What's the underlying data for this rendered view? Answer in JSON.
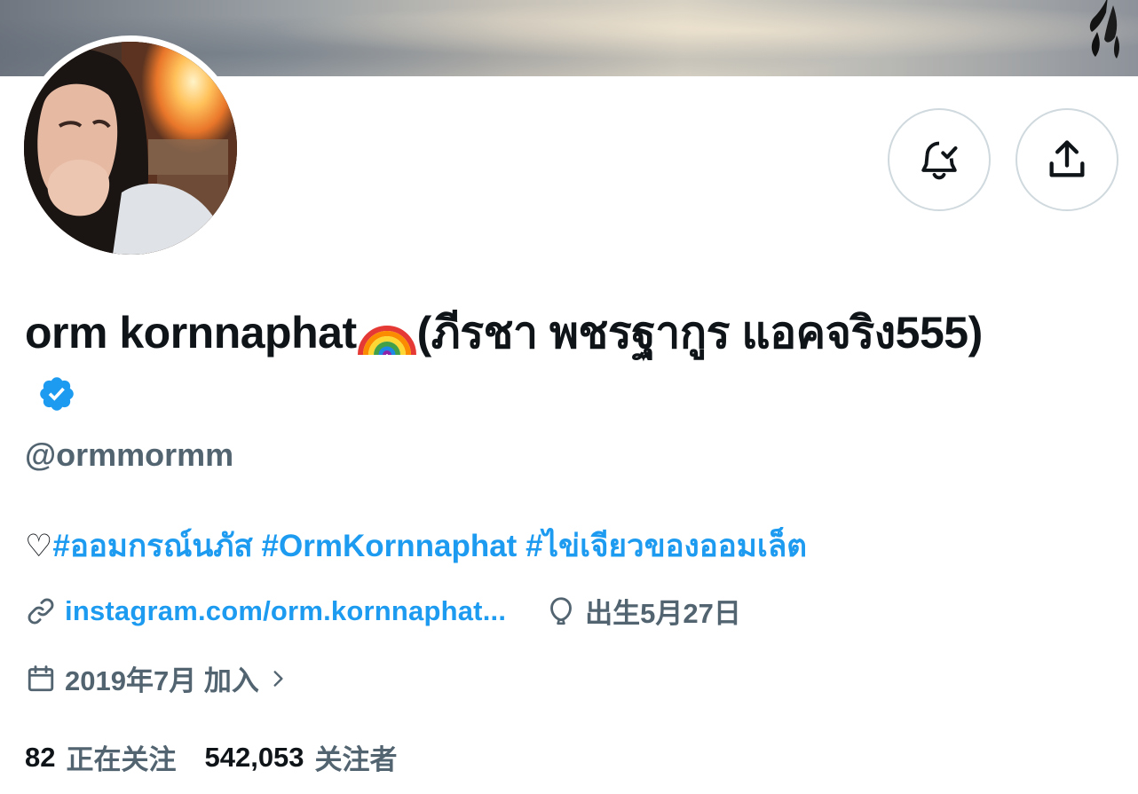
{
  "profile": {
    "name": "orm kornnaphat",
    "name_suffix": "(ภีรชา พชรฐากูร แอคจริง555)",
    "handle": "@ormmormm",
    "bio": {
      "heart": "♡",
      "hashtags": [
        "#ออมกรณ์นภัส",
        "#OrmKornnaphat",
        "#ไข่เจียวของออมเล็ต"
      ]
    },
    "website": "instagram.com/orm.kornnaphat...",
    "birthday": "出生5月27日",
    "joined": "2019年7月 加入",
    "following_count": "82",
    "following_label": "正在关注",
    "followers_count": "542,053",
    "followers_label": "关注者"
  },
  "icons": {
    "notify": "bell-check-icon",
    "share": "share-upload-icon",
    "verified": "verified-badge-icon",
    "link": "link-icon",
    "birthday": "balloon-icon",
    "calendar": "calendar-icon",
    "chevron": "chevron-right-icon"
  },
  "colors": {
    "accent": "#1d9bf0",
    "text": "#0f1419",
    "muted": "#536471",
    "border": "#cfd9de"
  }
}
